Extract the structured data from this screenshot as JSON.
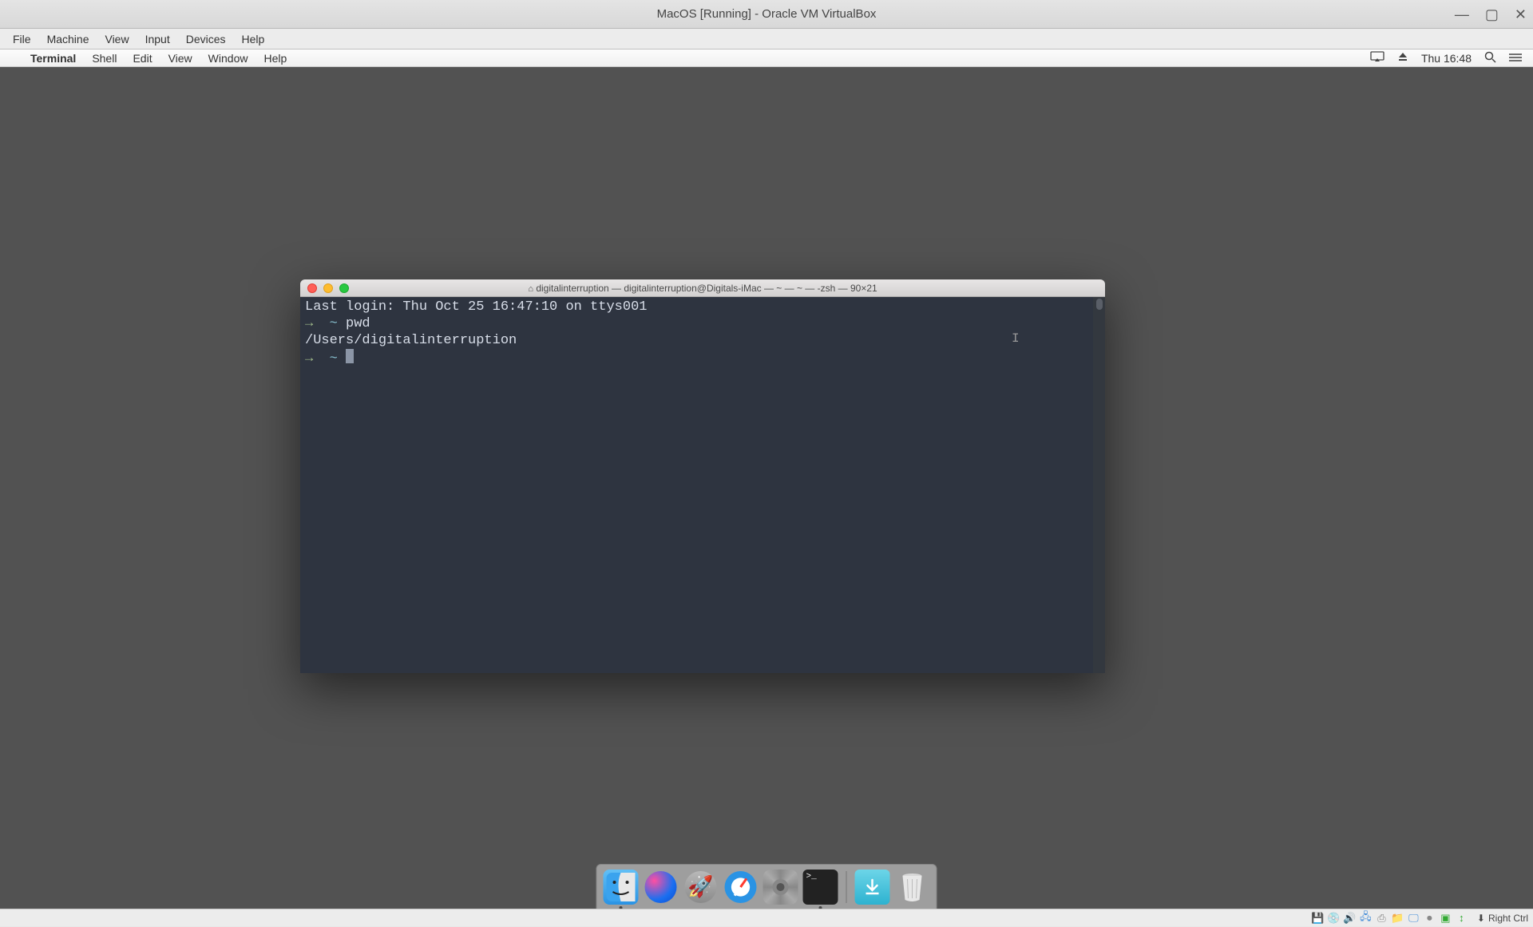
{
  "vbox": {
    "title": "MacOS [Running] - Oracle VM VirtualBox",
    "menu": {
      "file": "File",
      "machine": "Machine",
      "view": "View",
      "input": "Input",
      "devices": "Devices",
      "help": "Help"
    },
    "hostkey": "Right Ctrl"
  },
  "mac_menubar": {
    "app": "Terminal",
    "items": {
      "shell": "Shell",
      "edit": "Edit",
      "view": "View",
      "window": "Window",
      "help": "Help"
    },
    "clock": "Thu 16:48"
  },
  "terminal": {
    "title": "digitalinterruption — digitalinterruption@Digitals-iMac — ~ — ~ — -zsh — 90×21",
    "last_login": "Last login: Thu Oct 25 16:47:10 on ttys001",
    "prompt_arrow": "→",
    "prompt_tilde": "~",
    "cmd1": "pwd",
    "output1": "/Users/digitalinterruption"
  },
  "dock": {
    "finder": "finder-icon",
    "siri": "siri-icon",
    "launchpad": "launchpad-icon",
    "safari": "safari-icon",
    "sysprefs": "system-preferences-icon",
    "terminal": "terminal-icon",
    "terminal_glyph": ">_",
    "downloads": "downloads-icon",
    "trash": "trash-icon"
  }
}
